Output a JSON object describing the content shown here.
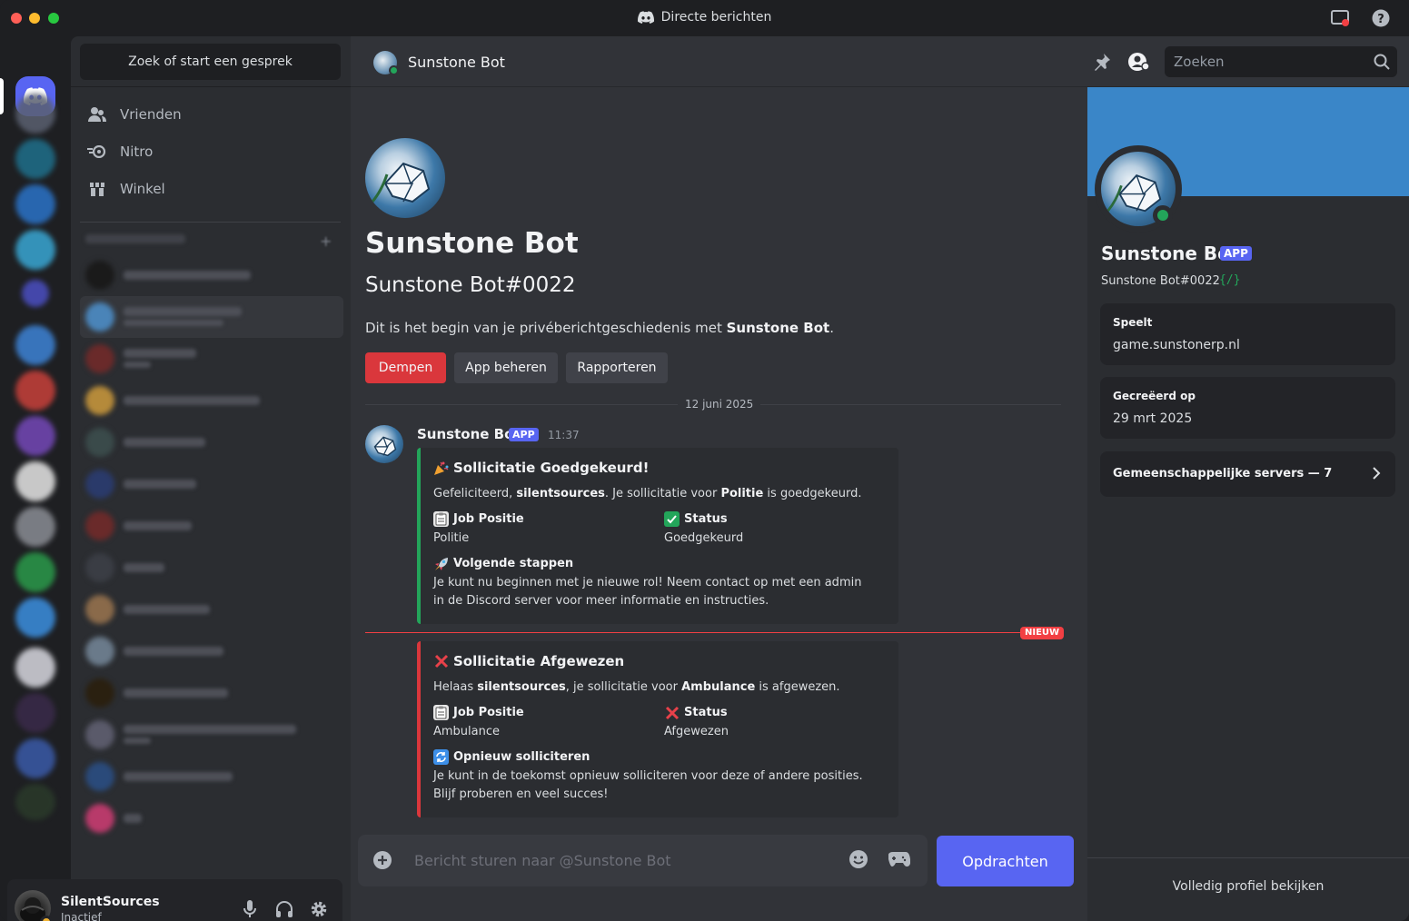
{
  "window": {
    "title": "Directe berichten"
  },
  "dm_sidebar": {
    "search_label": "Zoek of start een gesprek",
    "nav": [
      {
        "label": "Vrienden",
        "icon": "friends-icon"
      },
      {
        "label": "Nitro",
        "icon": "nitro-icon"
      },
      {
        "label": "Winkel",
        "icon": "shop-icon"
      }
    ]
  },
  "user_panel": {
    "name": "SilentSources",
    "status": "Inactief",
    "status_color": "#f0b232"
  },
  "chat": {
    "header_name": "Sunstone Bot",
    "search_placeholder": "Zoeken",
    "welcome": {
      "name": "Sunstone Bot",
      "tag": "Sunstone Bot#0022",
      "text_before": "Dit is het begin van je privéberichtgeschiedenis met ",
      "text_bold": "Sunstone Bot",
      "text_after": "."
    },
    "buttons": {
      "mute": "Dempen",
      "manage": "App beheren",
      "report": "Rapporteren"
    },
    "date_divider": "12 juni 2025",
    "new_badge": "NIEUW",
    "message": {
      "author": "Sunstone Bot",
      "badge": "APP",
      "time": "11:37",
      "embeds": [
        {
          "color": "#23a55a",
          "title_emoji": "party-popper-icon",
          "title": "Sollicitatie Goedgekeurd!",
          "desc_1": "Gefeliciteerd, ",
          "desc_bold_1": "silentsources",
          "desc_2": ". Je sollicitatie voor ",
          "desc_bold_2": "Politie",
          "desc_3": " is goedgekeurd.",
          "field1_name": "Job Positie",
          "field1_value": "Politie",
          "field2_name": "Status",
          "field2_value": "Goedgekeurd",
          "section_title": "Volgende stappen",
          "section_text": "Je kunt nu beginnen met je nieuwe rol! Neem contact op met een admin in de Discord server voor meer informatie en instructies."
        },
        {
          "color": "#da373c",
          "title_emoji": "cross-mark-icon",
          "title": "Sollicitatie Afgewezen",
          "desc_1": "Helaas ",
          "desc_bold_1": "silentsources",
          "desc_2": ", je sollicitatie voor ",
          "desc_bold_2": "Ambulance",
          "desc_3": " is afgewezen.",
          "field1_name": "Job Positie",
          "field1_value": "Ambulance",
          "field2_name": "Status",
          "field2_value": "Afgewezen",
          "section_title": "Opnieuw solliciteren",
          "section_text": "Je kunt in de toekomst opnieuw solliciteren voor deze of andere posities. Blijf proberen en veel succes!"
        }
      ]
    },
    "composer_placeholder": "Bericht sturen naar @Sunstone Bot",
    "commands_button": "Opdrachten"
  },
  "profile": {
    "name": "Sunstone Bot",
    "badge": "APP",
    "tag": "Sunstone Bot#0022",
    "tag_icon": "{/}",
    "playing_label": "Speelt",
    "playing_value": "game.sunstonerp.nl",
    "created_label": "Gecreëerd op",
    "created_value": "29 mrt 2025",
    "mutual_servers": "Gemeenschappelijke servers — 7",
    "full_profile": "Volledig profiel bekijken",
    "banner_color": "#3a86c8"
  },
  "colors": {
    "accent": "#5865f2",
    "danger": "#da373c",
    "online": "#23a55a"
  }
}
